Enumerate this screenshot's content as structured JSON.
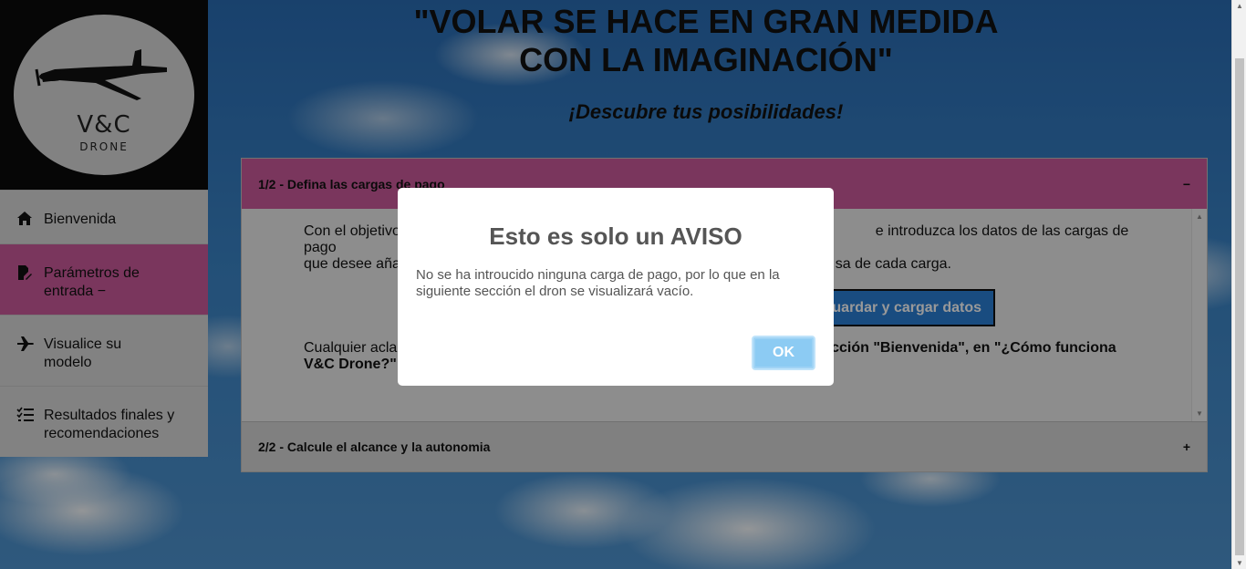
{
  "header": {
    "title_line1": "\"VOLAR SE HACE EN GRAN MEDIDA",
    "title_line2": "CON LA IMAGINACIÓN\"",
    "subtitle": "¡Descubre tus posibilidades!"
  },
  "logo": {
    "text": "V&C",
    "sub": "DRONE"
  },
  "sidebar": {
    "items": [
      {
        "label": "Bienvenida",
        "icon": "home-icon"
      },
      {
        "label": "Parámetros de entrada −",
        "icon": "edit-doc-icon",
        "active": true
      },
      {
        "label": "Visualice su modelo",
        "icon": "airplane-icon"
      },
      {
        "label": "Resultados finales y recomendaciones",
        "icon": "checklist-icon"
      }
    ]
  },
  "accordion": {
    "section1_title": "1/2 - Defina las cargas de pago",
    "section1_toggle": "−",
    "para1_left": "Con el objetivo",
    "para1_right": "e introduzca los datos de las cargas de pago",
    "para1_line2_left": "que desee aña",
    "para1_line2_right": "sa de cada carga.",
    "save_button": "Guardar y cargar datos",
    "para2_left": "Cualquier acla",
    "para2_right": "ección \"Bienvenida\", en \"¿Cómo funciona",
    "para2_line2": "V&C Drone?\"",
    "section2_title": "2/2 - Calcule el alcance y la autonomia",
    "section2_toggle": "+"
  },
  "modal": {
    "title": "Esto es solo un AVISO",
    "text": "No se ha introucido ninguna carga de pago, por lo que en la siguiente sección el dron se visualizará vacío.",
    "ok": "OK"
  },
  "colors": {
    "accent_pink": "#cc5b9b",
    "button_blue": "#2b7fd6",
    "ok_blue": "#8ccbf3"
  }
}
